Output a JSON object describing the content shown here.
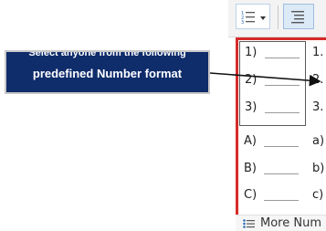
{
  "ribbon": {
    "numbering_icon": "numbering-list-icon",
    "dropdown_icon": "chevron-down-icon",
    "multilevel_icon": "multilevel-list-icon"
  },
  "library": {
    "items": [
      [
        "1)",
        "2)",
        "3)"
      ],
      [
        "1.",
        "2.",
        "3."
      ],
      [
        "A)",
        "B)",
        "C)"
      ],
      [
        "a)",
        "b)",
        "c)"
      ]
    ]
  },
  "footer": {
    "more_label": "More Num"
  },
  "callout": {
    "line1": "Select anyone from the following",
    "line2": "predefined Number format"
  },
  "colors": {
    "highlight": "#d72a2a",
    "callout_bg": "#0f2c6b"
  }
}
